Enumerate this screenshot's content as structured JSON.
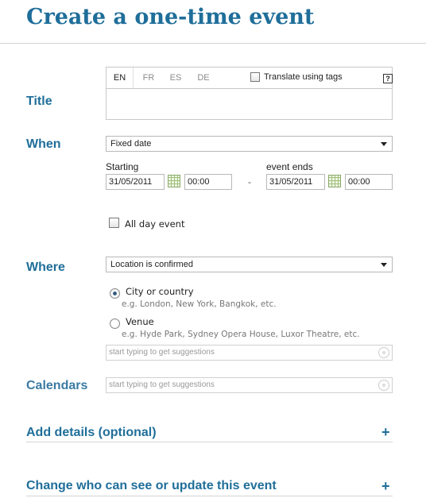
{
  "page": {
    "title": "Create a one-time event"
  },
  "title_section": {
    "label": "Title",
    "tabs": [
      {
        "label": "EN",
        "active": true
      },
      {
        "label": "FR",
        "active": false
      },
      {
        "label": "ES",
        "active": false
      },
      {
        "label": "DE",
        "active": false
      }
    ],
    "translate_label": "Translate using tags",
    "help_label": "?",
    "value": ""
  },
  "when": {
    "label": "When",
    "date_type": "Fixed date",
    "starting_label": "Starting",
    "start_date": "31/05/2011",
    "start_time": "00:00",
    "separator": "-",
    "ends_label": "event ends",
    "end_date": "31/05/2011",
    "end_time": "00:00",
    "all_day_label": "All day event"
  },
  "where": {
    "label": "Where",
    "location_status": "Location is confirmed",
    "city_option": "City or country",
    "city_hint": "e.g. London, New York, Bangkok, etc.",
    "venue_option": "Venue",
    "venue_hint": "e.g. Hyde Park, Sydney Opera House, Luxor Theatre, etc.",
    "suggest_placeholder": "start typing to get suggestions",
    "selected": "City or country"
  },
  "calendars": {
    "label": "Calendars",
    "suggest_placeholder": "start typing to get suggestions"
  },
  "add_details": {
    "label": "Add details (optional)",
    "expand": "+"
  },
  "permissions": {
    "label": "Change who can see or update this event",
    "expand": "+"
  },
  "colors": {
    "accent": "#1f6e9a",
    "rule": "#d4d4d4"
  },
  "icons": [
    "help-icon",
    "calendar-icon",
    "dropdown-arrow-icon",
    "clear-icon",
    "plus-icon"
  ]
}
